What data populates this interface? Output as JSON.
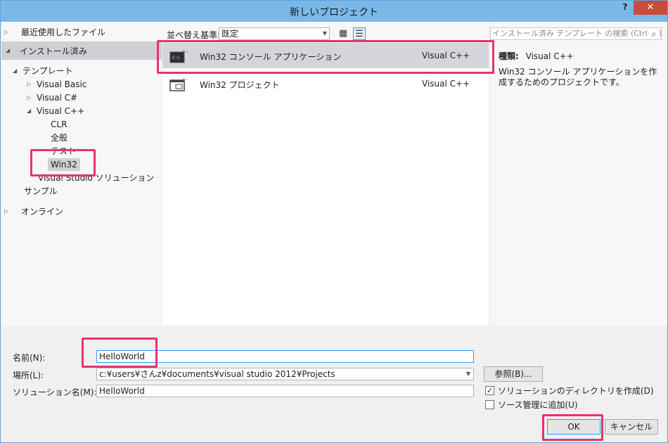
{
  "window": {
    "title": "新しいプロジェクト",
    "help": "?",
    "close": "✕"
  },
  "tree": {
    "recent": "最近使用したファイル",
    "installed": "インストール済み",
    "templates": "テンプレート",
    "vb": "Visual Basic",
    "cs": "Visual C#",
    "cpp": "Visual C++",
    "clr": "CLR",
    "general": "全般",
    "test": "テスト",
    "win32": "Win32",
    "vs_solution": "Visual Studio ソリューション",
    "samples": "サンプル",
    "online": "オンライン"
  },
  "toolbar": {
    "sort_label": "並べ替え基準:",
    "sort_value": "既定",
    "search_placeholder": "インストール済み テンプレート の検索 (Ctrl+E)"
  },
  "templates": [
    {
      "name": "Win32 コンソール アプリケーション",
      "lang": "Visual C++"
    },
    {
      "name": "Win32 プロジェクト",
      "lang": "Visual C++"
    }
  ],
  "info": {
    "type_label": "種類:",
    "type_value": "Visual C++",
    "description": "Win32 コンソール アプリケーションを作成するためのプロジェクトです。"
  },
  "form": {
    "name_label": "名前(N):",
    "name_value": "HelloWorld",
    "location_label": "場所(L):",
    "location_value": "c:¥users¥さんz¥documents¥visual studio 2012¥Projects",
    "solution_label": "ソリューション名(M):",
    "solution_value": "HelloWorld",
    "browse": "参照(B)...",
    "create_dir": "ソリューションのディレクトリを作成(D)",
    "add_scm": "ソース管理に追加(U)",
    "ok": "OK",
    "cancel": "キャンセル"
  },
  "colors": {
    "accent": "#e8336b",
    "titlebar": "#7ab8e8",
    "close": "#c74c3c"
  }
}
